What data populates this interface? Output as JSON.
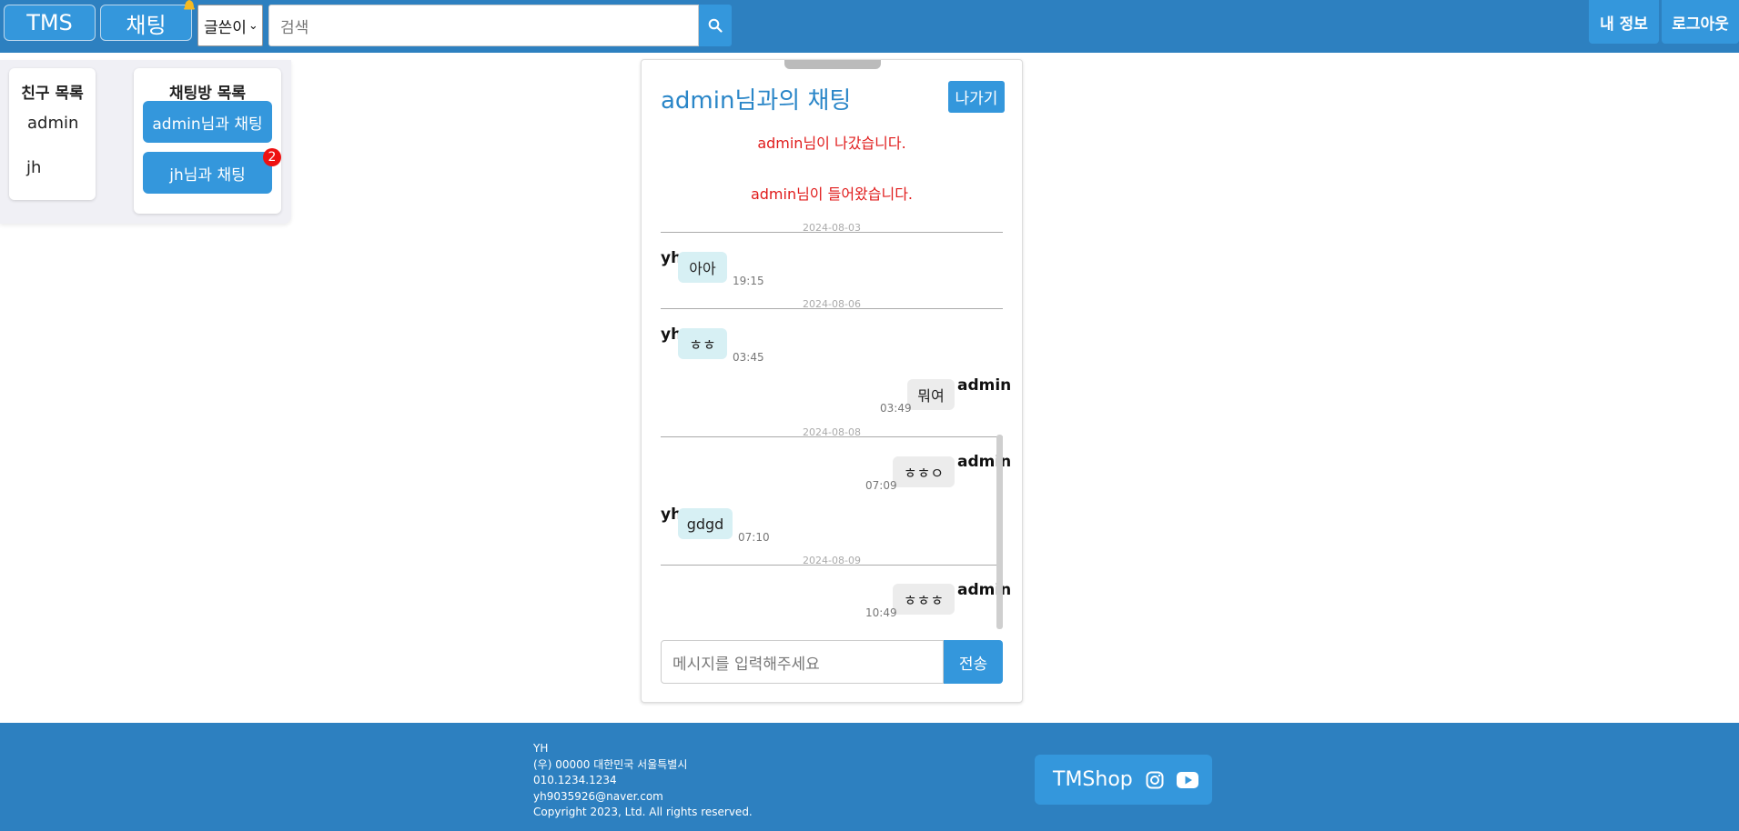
{
  "header": {
    "tms_label": "TMS",
    "chat_label": "채팅",
    "search_type": "글쓴이",
    "search_placeholder": "검색",
    "myinfo_label": "내 정보",
    "logout_label": "로그아웃"
  },
  "friends": {
    "title": "친구 목록",
    "items": [
      "admin",
      "jh"
    ]
  },
  "rooms": {
    "title": "채팅방 목록",
    "items": [
      {
        "label": "admin님과 채팅"
      },
      {
        "label": "jh님과 채팅",
        "unread": "2"
      }
    ]
  },
  "chat": {
    "title": "admin님과의 채팅",
    "exit_label": "나가기",
    "system_messages": [
      "admin님이 나갔습니다.",
      "admin님이 들어왔습니다."
    ],
    "dates": [
      "2024-08-03",
      "2024-08-06",
      "2024-08-08",
      "2024-08-09"
    ],
    "messages": [
      {
        "sender": "yh",
        "text": "아아",
        "time": "19:15"
      },
      {
        "sender": "yh",
        "text": "ㅎㅎ",
        "time": "03:45"
      },
      {
        "sender": "admin",
        "text": "뭐여",
        "time": "03:49"
      },
      {
        "sender": "admin",
        "text": "ㅎㅎㅇ",
        "time": "07:09"
      },
      {
        "sender": "yh",
        "text": "gdgd",
        "time": "07:10"
      },
      {
        "sender": "admin",
        "text": "ㅎㅎㅎ",
        "time": "10:49"
      }
    ],
    "input_placeholder": "메시지를 입력해주세요",
    "send_label": "전송"
  },
  "footer": {
    "lines": [
      "YH",
      "(우) 00000 대한민국 서울특별시",
      "010.1234.1234",
      "yh9035926@naver.com",
      "Copyright 2023, Ltd. All rights reserved."
    ],
    "brand": "TMShop"
  },
  "colors": {
    "primary": "#2d80c0",
    "button": "#3497dc",
    "system_text": "#e01b1b",
    "incoming_bubble": "#d7f0f4",
    "outgoing_bubble": "#ececec",
    "badge": "#ee1111"
  },
  "icons": [
    "bell-icon",
    "search-icon",
    "instagram-icon",
    "youtube-icon"
  ]
}
